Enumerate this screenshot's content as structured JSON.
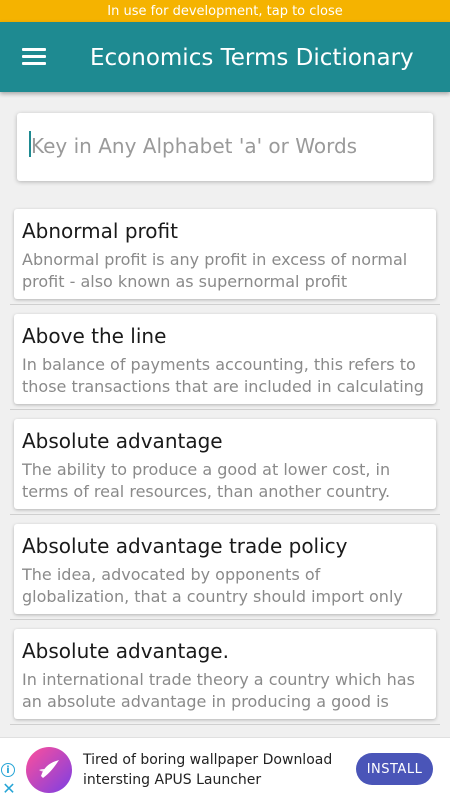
{
  "dev_banner": {
    "text": "In use for development, tap to close"
  },
  "app_bar": {
    "title": "Economics Terms Dictionary",
    "menu_icon": "hamburger-menu-icon",
    "color": "#1e8a91"
  },
  "search": {
    "placeholder": "Key in Any Alphabet 'a' or Words",
    "value": ""
  },
  "entries": [
    {
      "term": "Abnormal profit",
      "definition": "Abnormal profit is any profit in excess of normal profit - also known as supernormal profit"
    },
    {
      "term": "Above the line",
      "definition": "In balance of payments accounting, this refers to those transactions that are included in calculating"
    },
    {
      "term": "Absolute advantage",
      "definition": "The ability to produce a good at lower cost, in terms of real resources, than another country."
    },
    {
      "term": "Absolute advantage trade policy",
      "definition": "The idea, advocated by opponents of globalization, that a country should import only"
    },
    {
      "term": "Absolute advantage.",
      "definition": "In international trade theory a country which has an absolute advantage in producing a good is"
    }
  ],
  "ad": {
    "text": "Tired of boring wallpaper Download intersting APUS Launcher",
    "button_label": "INSTALL",
    "info_icon": "ad-info-icon",
    "close_icon": "ad-close-icon"
  }
}
